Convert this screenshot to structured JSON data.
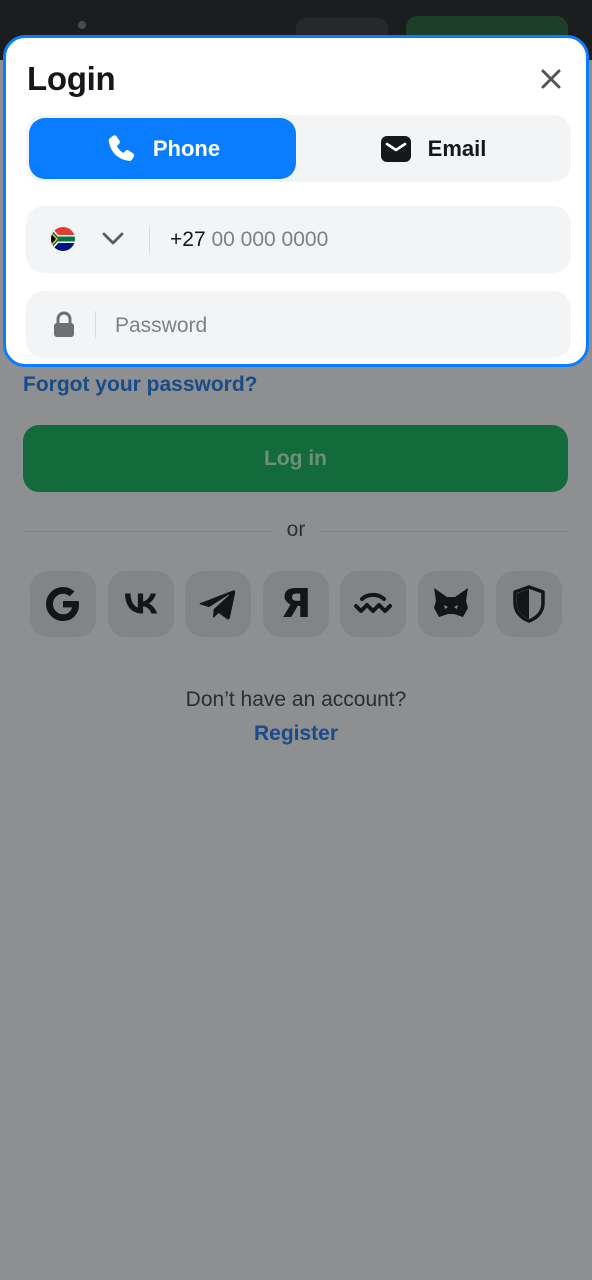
{
  "login": {
    "title": "Login",
    "tabs": [
      {
        "label": "Phone",
        "icon": "phone-icon",
        "active": true
      },
      {
        "label": "Email",
        "icon": "email-icon",
        "active": false
      }
    ],
    "phone": {
      "country_flag": "south-africa-flag-icon",
      "dial_code": "+27",
      "placeholder": "00 000 0000"
    },
    "password": {
      "placeholder": "Password"
    },
    "forgot_link": "Forgot your password?",
    "submit_label": "Log in",
    "separator": "or",
    "social_logins": [
      "google-icon",
      "vk-icon",
      "telegram-icon",
      "yandex-icon",
      "walletconnect-icon",
      "metamask-icon",
      "shield-icon"
    ],
    "no_account_text": "Don’t have an account?",
    "register_link": "Register"
  },
  "colors": {
    "accent_blue": "#0a7cff",
    "primary_green": "#149a4f",
    "link_blue": "#1f66c1",
    "overlay": "#8e8f90"
  }
}
